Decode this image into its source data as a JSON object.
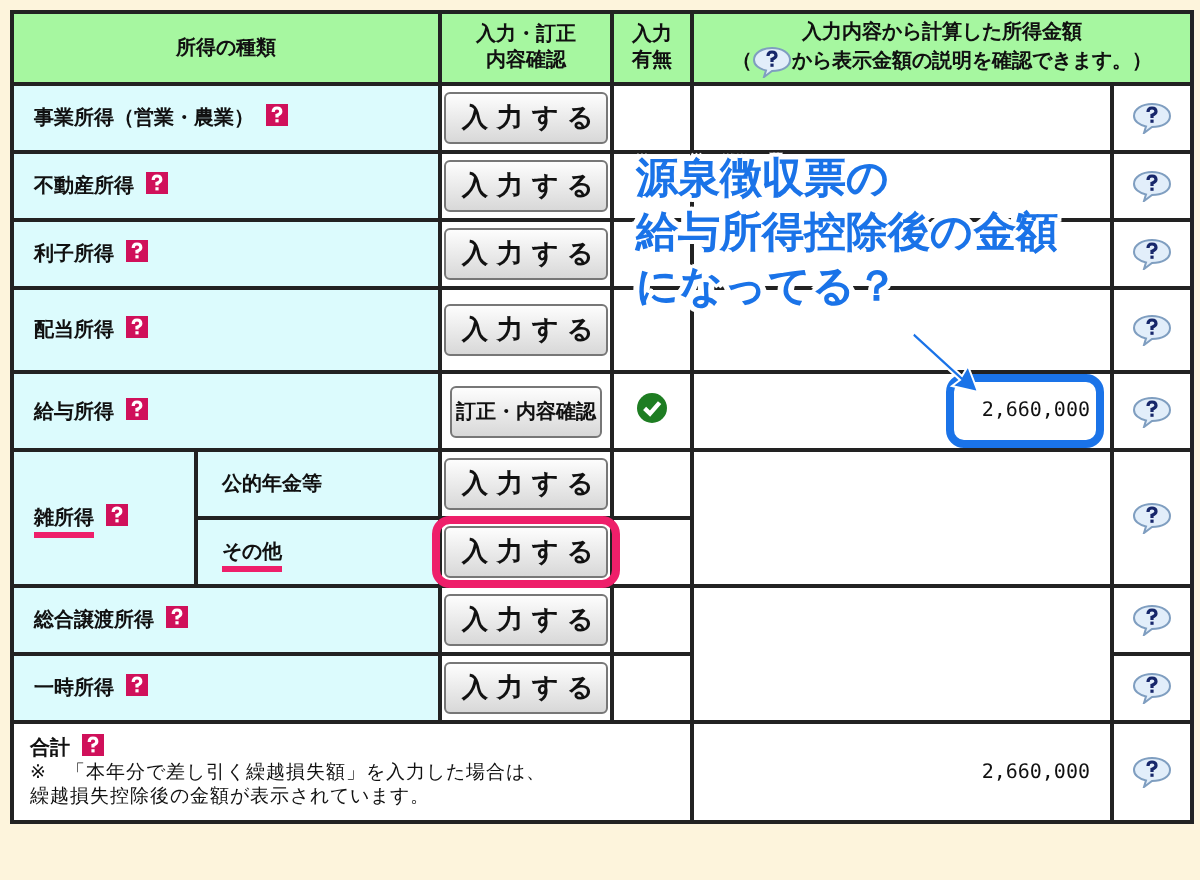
{
  "header": {
    "type_col": "所得の種類",
    "input_col": [
      "入力・訂正",
      "内容確認"
    ],
    "presence_col": [
      "入力",
      "有無"
    ],
    "amount_col": "入力内容から計算した所得金額",
    "amount_note_before": "（",
    "amount_note_after": "から表示金額の説明を確認できます。）"
  },
  "rows": [
    {
      "kind": "single",
      "label": "事業所得（営業・農業）",
      "button": "入力する",
      "entered": false
    },
    {
      "kind": "single",
      "label": "不動産所得",
      "button": "入力する",
      "entered": false
    },
    {
      "kind": "single",
      "label": "利子所得",
      "button": "入力する",
      "entered": false
    },
    {
      "kind": "single",
      "label": "配当所得",
      "button": "入力する",
      "entered": false
    },
    {
      "kind": "single",
      "label": "給与所得",
      "button": "訂正・内容確認",
      "entered": true,
      "amount": "2,660,000",
      "amount_highlighted": true
    },
    {
      "kind": "group",
      "label": "雑所得",
      "underlined": true,
      "children": [
        {
          "label": "公的年金等",
          "button": "入力する",
          "entered": false,
          "underlined": false,
          "highlighted": false
        },
        {
          "label": "その他",
          "button": "入力する",
          "entered": false,
          "underlined": true,
          "highlighted": true
        }
      ]
    },
    {
      "kind": "pair",
      "children": [
        {
          "label": "総合譲渡所得",
          "button": "入力する",
          "entered": false
        },
        {
          "label": "一時所得",
          "button": "入力する",
          "entered": false
        }
      ]
    }
  ],
  "total": {
    "label": "合計",
    "note": [
      "※　「本年分で差し引く繰越損失額」を入力した場合は、",
      "繰越損失控除後の金額が表示されています。"
    ],
    "amount": "2,660,000"
  },
  "callout": {
    "lines": [
      "源泉徴収票の",
      "給与所得控除後の金額",
      "になってる？"
    ]
  }
}
